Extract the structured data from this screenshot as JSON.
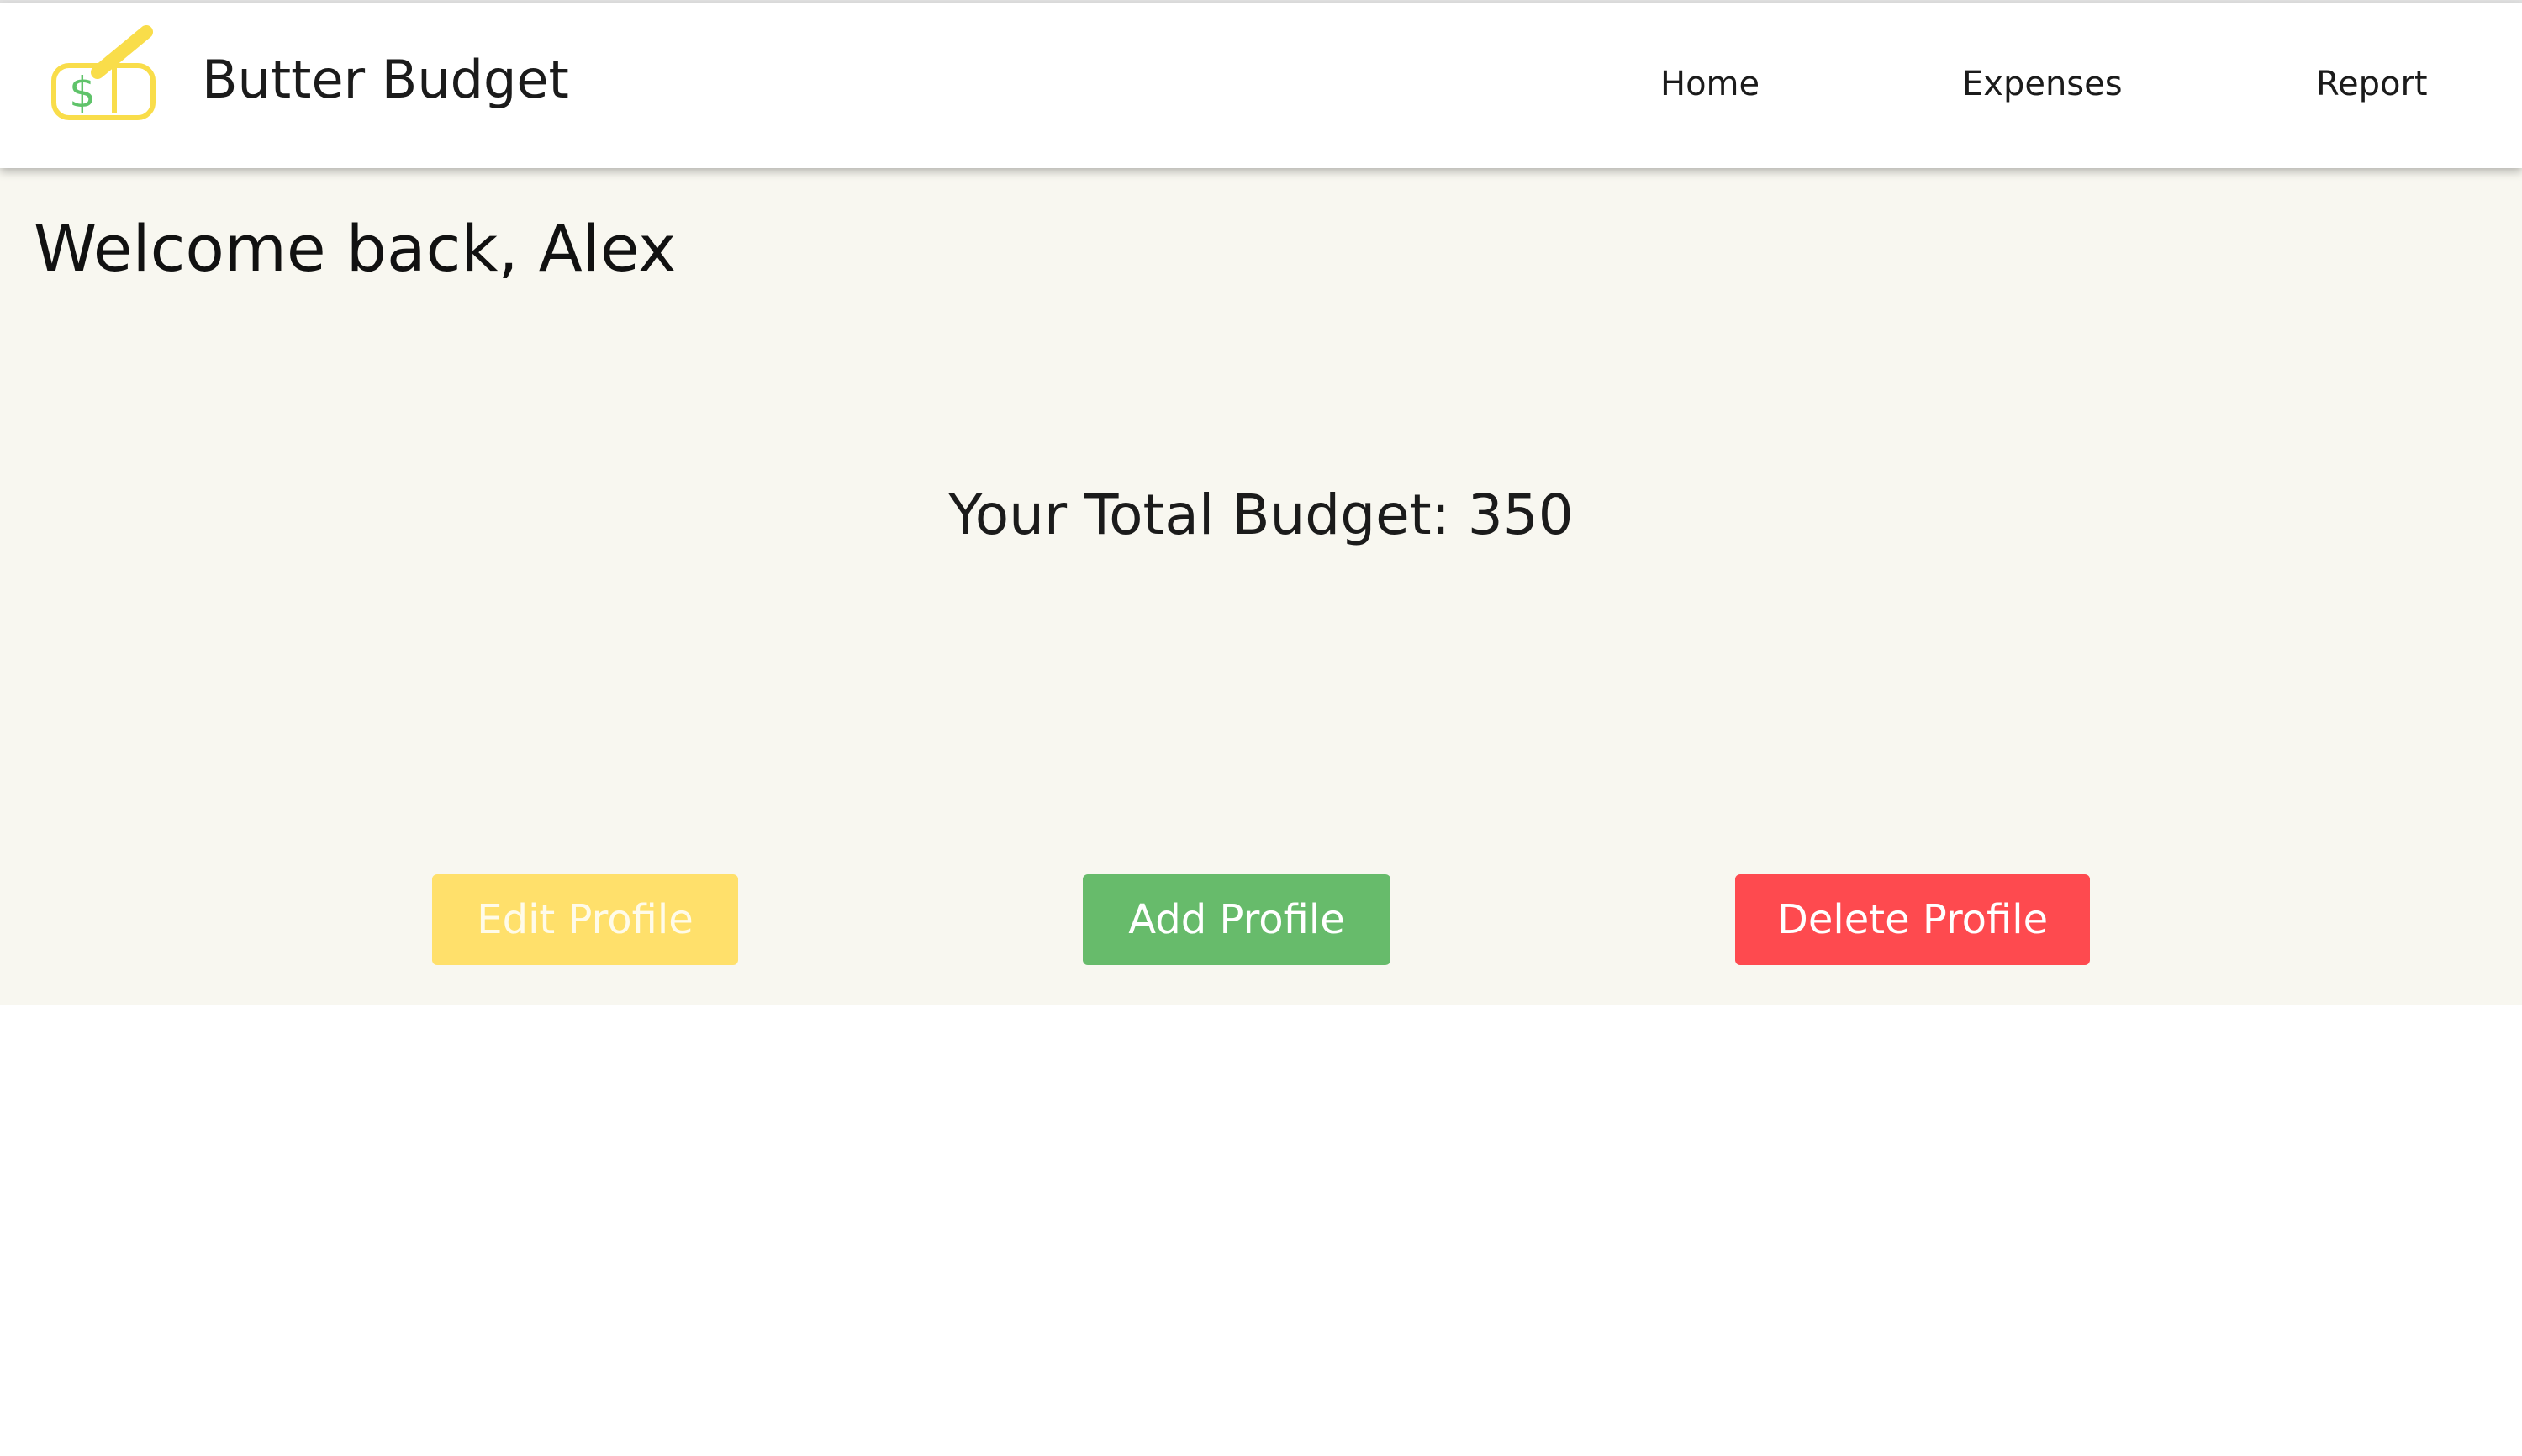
{
  "nav": {
    "brand": "Butter Budget",
    "links": [
      {
        "label": "Home"
      },
      {
        "label": "Expenses"
      },
      {
        "label": "Report"
      }
    ]
  },
  "main": {
    "welcome": "Welcome back, Alex",
    "budget_text": "Your Total Budget: 350",
    "buttons": {
      "edit": "Edit Profile",
      "add": "Add Profile",
      "delete": "Delete Profile"
    }
  },
  "colors": {
    "background": "#f8f7f0",
    "edit": "#ffe06b",
    "add": "#67bb6b",
    "delete": "#fe4a4f",
    "logo_butter": "#f9dd4a",
    "logo_dollar": "#5fc36a"
  },
  "icons": {
    "logo": "butter-budget-logo-icon"
  }
}
